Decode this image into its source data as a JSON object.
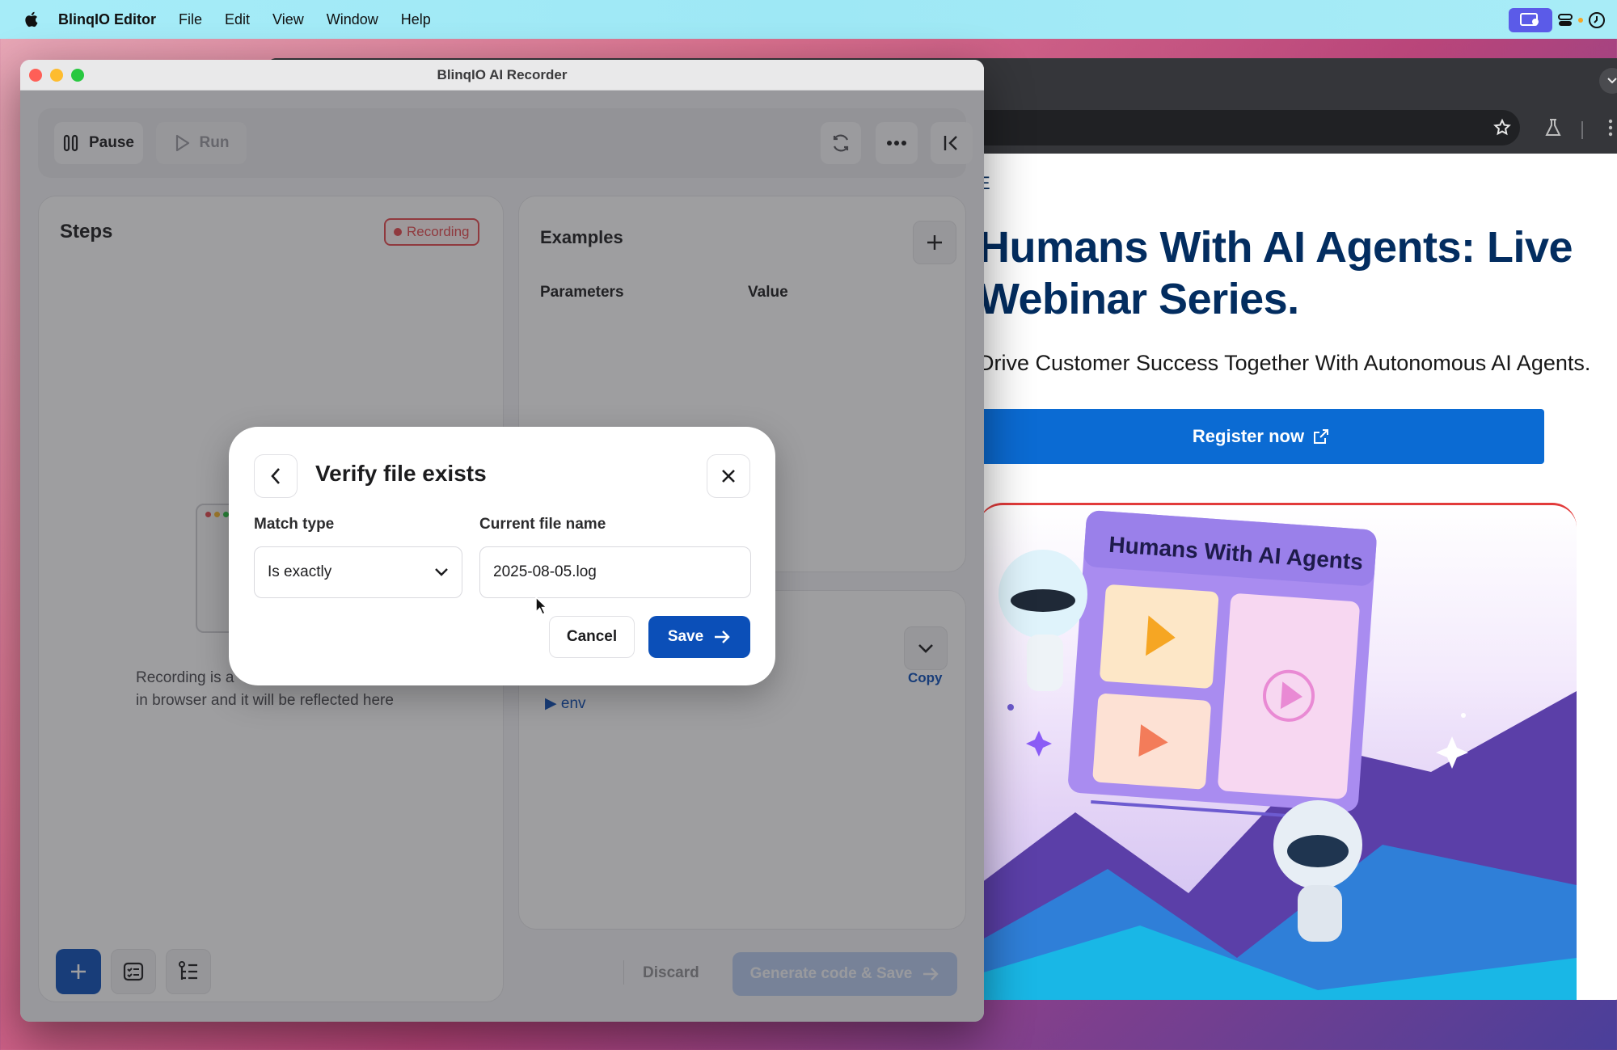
{
  "menubar": {
    "app_name": "BlinqIO Editor",
    "items": [
      "File",
      "Edit",
      "View",
      "Window",
      "Help"
    ]
  },
  "recorder": {
    "window_title": "BlinqIO AI Recorder",
    "toolbar": {
      "pause_label": "Pause",
      "run_label": "Run"
    },
    "steps": {
      "title": "Steps",
      "badge": "Recording",
      "empty_line1": "Recording is a",
      "empty_line2": "in browser and it will be reflected here"
    },
    "examples": {
      "title": "Examples",
      "col_parameters": "Parameters",
      "col_value": "Value"
    },
    "env": {
      "copy_label": "Copy",
      "env_label": "▶ env"
    },
    "footer": {
      "discard_label": "Discard",
      "generate_label": "Generate code & Save"
    }
  },
  "modal": {
    "title": "Verify file exists",
    "match_type_label": "Match type",
    "match_type_value": "Is exactly",
    "file_name_label": "Current file name",
    "file_name_value": "2025-08-05.log",
    "cancel_label": "Cancel",
    "save_label": "Save"
  },
  "webpage": {
    "nav_letter": "E",
    "headline_line1": "Humans With AI Agents: Live",
    "headline_line2": "Webinar Series.",
    "subline": "Drive Customer Success Together With Autonomous AI Agents.",
    "register_label": "Register now",
    "hero_title": "Humans With AI Agents"
  },
  "colors": {
    "primary": "#0b4fb8",
    "recording": "#e5484d",
    "page_navy": "#032d60",
    "register_blue": "#0b6bd3"
  }
}
